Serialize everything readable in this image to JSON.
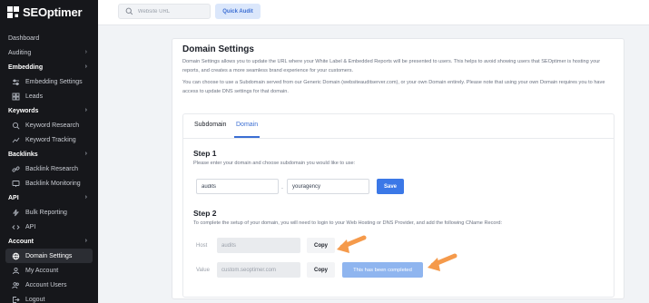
{
  "brand": {
    "name": "SEOptimer",
    "accent": "#3b78e7",
    "arrow_color": "#f59a4b"
  },
  "sidebar": {
    "items": [
      {
        "label": "Dashboard",
        "kind": "top",
        "chevron": false
      },
      {
        "label": "Auditing",
        "kind": "top",
        "chevron": true
      },
      {
        "label": "Embedding",
        "kind": "section",
        "chevron": true
      },
      {
        "label": "Embedding Settings",
        "kind": "sub",
        "icon": "sliders-icon"
      },
      {
        "label": "Leads",
        "kind": "sub",
        "icon": "grid-icon"
      },
      {
        "label": "Keywords",
        "kind": "section",
        "chevron": true
      },
      {
        "label": "Keyword Research",
        "kind": "sub",
        "icon": "search-icon"
      },
      {
        "label": "Keyword Tracking",
        "kind": "sub",
        "icon": "chart-icon"
      },
      {
        "label": "Backlinks",
        "kind": "section",
        "chevron": true
      },
      {
        "label": "Backlink Research",
        "kind": "sub",
        "icon": "link-icon"
      },
      {
        "label": "Backlink Monitoring",
        "kind": "sub",
        "icon": "monitor-icon"
      },
      {
        "label": "API",
        "kind": "section",
        "chevron": true
      },
      {
        "label": "Bulk Reporting",
        "kind": "sub",
        "icon": "bolt-icon"
      },
      {
        "label": "API",
        "kind": "sub",
        "icon": "code-icon"
      },
      {
        "label": "Account",
        "kind": "section",
        "chevron": true
      },
      {
        "label": "Domain Settings",
        "kind": "sub",
        "icon": "globe-icon",
        "active": true
      },
      {
        "label": "My Account",
        "kind": "sub",
        "icon": "user-icon"
      },
      {
        "label": "Account Users",
        "kind": "sub",
        "icon": "users-icon"
      },
      {
        "label": "Logout",
        "kind": "sub",
        "icon": "logout-icon"
      }
    ]
  },
  "topbar": {
    "search_placeholder": "Website URL",
    "quick_audit_label": "Quick Audit"
  },
  "page": {
    "title": "Domain Settings",
    "desc1": "Domain Settings allows you to update the URL where your White Label & Embedded Reports will be presented to users. This helps to avoid showing users that SEOptimer is hosting your reports, and creates a more seamless brand experience for your customers.",
    "desc2": "You can choose to use a Subdomain served from our Generic Domain (websiteauditserver.com), or your own Domain entirely. Please note that using your own Domain requires you to have access to update DNS settings for that domain.",
    "tabs": [
      {
        "label": "Subdomain",
        "active": false
      },
      {
        "label": "Domain",
        "active": true
      }
    ],
    "step1": {
      "title": "Step 1",
      "desc": "Please enter your domain and choose subdomain you would like to use:",
      "subdomain_value": "audits",
      "separator": ".",
      "domain_value": "youragency",
      "save_label": "Save"
    },
    "step2": {
      "title": "Step 2",
      "desc": "To complete the setup of your domain, you will need to login to your Web Hosting or DNS Provider, and add the following CName Record:",
      "host_label": "Host",
      "host_value": "audits",
      "value_label": "Value",
      "value_value": "custom.seoptimer.com",
      "copy_label": "Copy",
      "completed_label": "This has been completed"
    }
  }
}
